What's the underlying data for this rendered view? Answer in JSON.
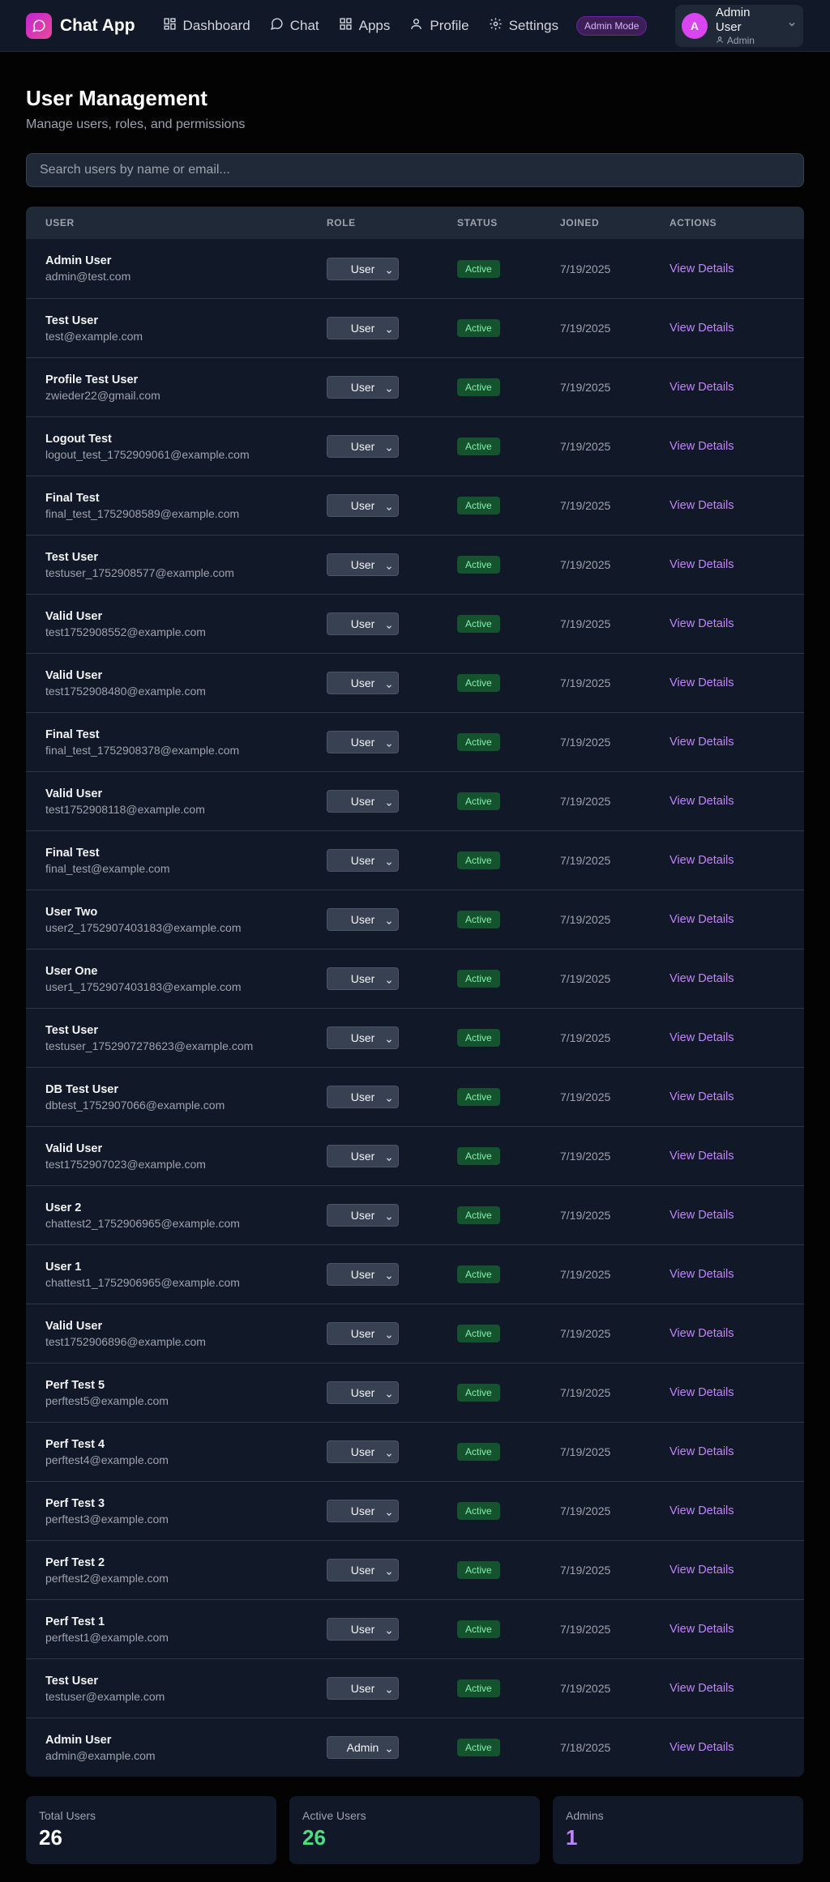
{
  "app": {
    "name": "Chat App",
    "admin_mode_label": "Admin Mode"
  },
  "nav": [
    {
      "label": "Dashboard",
      "icon": "dashboard-icon"
    },
    {
      "label": "Chat",
      "icon": "chat-icon"
    },
    {
      "label": "Apps",
      "icon": "apps-icon"
    },
    {
      "label": "Profile",
      "icon": "profile-icon"
    },
    {
      "label": "Settings",
      "icon": "settings-icon"
    }
  ],
  "current_user": {
    "initial": "A",
    "name": "Admin User",
    "role": "Admin"
  },
  "page": {
    "title": "User Management",
    "subtitle": "Manage users, roles, and permissions"
  },
  "search": {
    "placeholder": "Search users by name or email...",
    "value": ""
  },
  "table": {
    "headers": {
      "user": "USER",
      "role": "ROLE",
      "status": "STATUS",
      "joined": "JOINED",
      "actions": "ACTIONS"
    },
    "action_label": "View Details",
    "rows": [
      {
        "name": "Admin User",
        "email": "admin@test.com",
        "role": "User",
        "status": "Active",
        "joined": "7/19/2025"
      },
      {
        "name": "Test User",
        "email": "test@example.com",
        "role": "User",
        "status": "Active",
        "joined": "7/19/2025"
      },
      {
        "name": "Profile Test User",
        "email": "zwieder22@gmail.com",
        "role": "User",
        "status": "Active",
        "joined": "7/19/2025"
      },
      {
        "name": "Logout Test",
        "email": "logout_test_1752909061@example.com",
        "role": "User",
        "status": "Active",
        "joined": "7/19/2025"
      },
      {
        "name": "Final Test",
        "email": "final_test_1752908589@example.com",
        "role": "User",
        "status": "Active",
        "joined": "7/19/2025"
      },
      {
        "name": "Test User",
        "email": "testuser_1752908577@example.com",
        "role": "User",
        "status": "Active",
        "joined": "7/19/2025"
      },
      {
        "name": "Valid User",
        "email": "test1752908552@example.com",
        "role": "User",
        "status": "Active",
        "joined": "7/19/2025"
      },
      {
        "name": "Valid User",
        "email": "test1752908480@example.com",
        "role": "User",
        "status": "Active",
        "joined": "7/19/2025"
      },
      {
        "name": "Final Test",
        "email": "final_test_1752908378@example.com",
        "role": "User",
        "status": "Active",
        "joined": "7/19/2025"
      },
      {
        "name": "Valid User",
        "email": "test1752908118@example.com",
        "role": "User",
        "status": "Active",
        "joined": "7/19/2025"
      },
      {
        "name": "Final Test",
        "email": "final_test@example.com",
        "role": "User",
        "status": "Active",
        "joined": "7/19/2025"
      },
      {
        "name": "User Two",
        "email": "user2_1752907403183@example.com",
        "role": "User",
        "status": "Active",
        "joined": "7/19/2025"
      },
      {
        "name": "User One",
        "email": "user1_1752907403183@example.com",
        "role": "User",
        "status": "Active",
        "joined": "7/19/2025"
      },
      {
        "name": "Test User",
        "email": "testuser_1752907278623@example.com",
        "role": "User",
        "status": "Active",
        "joined": "7/19/2025"
      },
      {
        "name": "DB Test User",
        "email": "dbtest_1752907066@example.com",
        "role": "User",
        "status": "Active",
        "joined": "7/19/2025"
      },
      {
        "name": "Valid User",
        "email": "test1752907023@example.com",
        "role": "User",
        "status": "Active",
        "joined": "7/19/2025"
      },
      {
        "name": "User 2",
        "email": "chattest2_1752906965@example.com",
        "role": "User",
        "status": "Active",
        "joined": "7/19/2025"
      },
      {
        "name": "User 1",
        "email": "chattest1_1752906965@example.com",
        "role": "User",
        "status": "Active",
        "joined": "7/19/2025"
      },
      {
        "name": "Valid User",
        "email": "test1752906896@example.com",
        "role": "User",
        "status": "Active",
        "joined": "7/19/2025"
      },
      {
        "name": "Perf Test 5",
        "email": "perftest5@example.com",
        "role": "User",
        "status": "Active",
        "joined": "7/19/2025"
      },
      {
        "name": "Perf Test 4",
        "email": "perftest4@example.com",
        "role": "User",
        "status": "Active",
        "joined": "7/19/2025"
      },
      {
        "name": "Perf Test 3",
        "email": "perftest3@example.com",
        "role": "User",
        "status": "Active",
        "joined": "7/19/2025"
      },
      {
        "name": "Perf Test 2",
        "email": "perftest2@example.com",
        "role": "User",
        "status": "Active",
        "joined": "7/19/2025"
      },
      {
        "name": "Perf Test 1",
        "email": "perftest1@example.com",
        "role": "User",
        "status": "Active",
        "joined": "7/19/2025"
      },
      {
        "name": "Test User",
        "email": "testuser@example.com",
        "role": "User",
        "status": "Active",
        "joined": "7/19/2025"
      },
      {
        "name": "Admin User",
        "email": "admin@example.com",
        "role": "Admin",
        "status": "Active",
        "joined": "7/18/2025"
      }
    ]
  },
  "stats": [
    {
      "label": "Total Users",
      "value": "26",
      "color": "#ffffff"
    },
    {
      "label": "Active Users",
      "value": "26",
      "color": "#4ade80"
    },
    {
      "label": "Admins",
      "value": "1",
      "color": "#c084fc"
    }
  ],
  "colors": {
    "accent": "#c084fc",
    "brand_gradient_start": "#c026d3",
    "brand_gradient_end": "#ec4899",
    "active_badge_bg": "#14532d",
    "active_badge_text": "#86efac"
  }
}
